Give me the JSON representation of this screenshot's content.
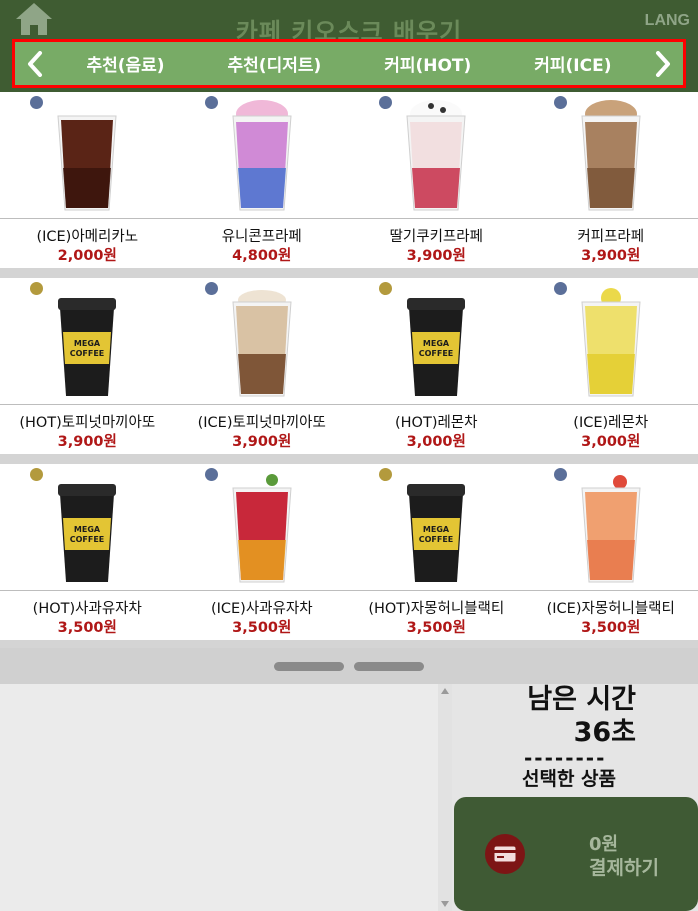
{
  "header": {
    "title": "카페 키오스크 배우기",
    "lang": "LANG",
    "colors": {
      "background": "#3f5c32",
      "category_bar": "#78ab66",
      "highlight_border": "#ff0000"
    }
  },
  "categories": [
    {
      "label": "추천(음료)"
    },
    {
      "label": "추천(디저트)"
    },
    {
      "label": "커피(HOT)"
    },
    {
      "label": "커피(ICE)"
    }
  ],
  "menu": [
    {
      "name": "(ICE)아메리카노",
      "price": "2,000원",
      "badge": "new",
      "cup": "iced-americano"
    },
    {
      "name": "유니콘프라페",
      "price": "4,800원",
      "badge": "new",
      "cup": "unicorn-frappe"
    },
    {
      "name": "딸기쿠키프라페",
      "price": "3,900원",
      "badge": "new",
      "cup": "strawberry-cookie-frappe"
    },
    {
      "name": "커피프라페",
      "price": "3,900원",
      "badge": "new",
      "cup": "coffee-frappe"
    },
    {
      "name": "(HOT)토피넛마끼아또",
      "price": "3,900원",
      "badge": "best",
      "cup": "hot-cup"
    },
    {
      "name": "(ICE)토피넛마끼아또",
      "price": "3,900원",
      "badge": "new",
      "cup": "iced-macchiato"
    },
    {
      "name": "(HOT)레몬차",
      "price": "3,000원",
      "badge": "best",
      "cup": "hot-cup"
    },
    {
      "name": "(ICE)레몬차",
      "price": "3,000원",
      "badge": "new",
      "cup": "iced-lemon"
    },
    {
      "name": "(HOT)사과유자차",
      "price": "3,500원",
      "badge": "best",
      "cup": "hot-cup"
    },
    {
      "name": "(ICE)사과유자차",
      "price": "3,500원",
      "badge": "new",
      "cup": "iced-apple-yuzu"
    },
    {
      "name": "(HOT)자몽허니블랙티",
      "price": "3,500원",
      "badge": "best",
      "cup": "hot-cup"
    },
    {
      "name": "(ICE)자몽허니블랙티",
      "price": "3,500원",
      "badge": "new",
      "cup": "iced-grapefruit"
    }
  ],
  "cup_label": {
    "line1": "MEGA",
    "line2": "COFFEE"
  },
  "timer": {
    "label": "남은 시간",
    "value": "36초"
  },
  "cart": {
    "divider": "--------",
    "selected_label": "선택한 상품"
  },
  "payment": {
    "amount": "0원",
    "label": "결제하기"
  }
}
